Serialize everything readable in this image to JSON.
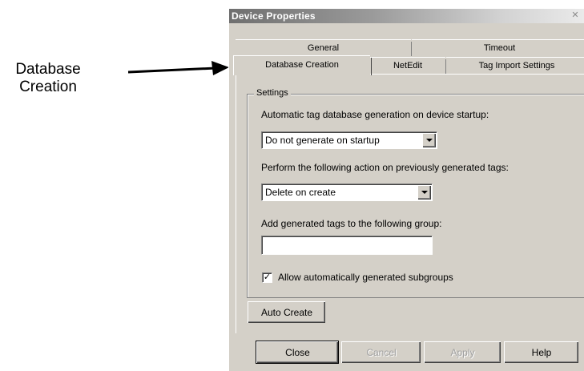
{
  "annotation": {
    "line1": "Database",
    "line2": "Creation"
  },
  "dialog": {
    "title": "Device Properties",
    "close_glyph": "✕",
    "tabs_back": [
      "General",
      "Timeout"
    ],
    "tabs_front": [
      "Database Creation",
      "NetEdit",
      "Tag Import Settings"
    ],
    "group_label": "Settings",
    "startup_label": "Automatic tag database generation on device startup:",
    "startup_value": "Do not generate on startup",
    "previous_label": "Perform the following action on previously generated tags:",
    "previous_value": "Delete on create",
    "group_field_label": "Add generated tags to the following group:",
    "group_field_value": "",
    "subgroups_label": "Allow automatically generated subgroups",
    "subgroups_checked": "✓",
    "auto_create": "Auto Create",
    "buttons": {
      "close": "Close",
      "cancel": "Cancel",
      "apply": "Apply",
      "help": "Help"
    }
  }
}
